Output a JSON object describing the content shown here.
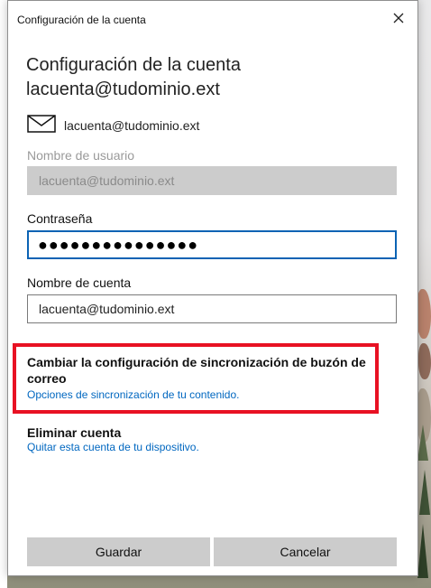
{
  "window": {
    "title": "Configuración de la cuenta"
  },
  "heading": {
    "line1": "Configuración de la cuenta",
    "line2": "lacuenta@tudominio.ext"
  },
  "account": {
    "icon": "mail-icon",
    "email": "lacuenta@tudominio.ext"
  },
  "form": {
    "username": {
      "label": "Nombre de usuario",
      "value": "lacuenta@tudominio.ext",
      "disabled": true
    },
    "password": {
      "label": "Contraseña",
      "value": "●●●●●●●●●●●●●●●",
      "focused": true
    },
    "account_name": {
      "label": "Nombre de cuenta",
      "value": "lacuenta@tudominio.ext"
    }
  },
  "sync_settings": {
    "title": "Cambiar la configuración de sincronización de buzón de correo",
    "link": "Opciones de sincronización de tu contenido.",
    "highlight_color": "#e81123"
  },
  "delete_account": {
    "title": "Eliminar cuenta",
    "link": "Quitar esta cuenta de tu dispositivo."
  },
  "buttons": {
    "save": "Guardar",
    "cancel": "Cancelar"
  },
  "colors": {
    "accent": "#0b63b4",
    "link": "#0067c0",
    "button_bg": "#cccccc"
  }
}
